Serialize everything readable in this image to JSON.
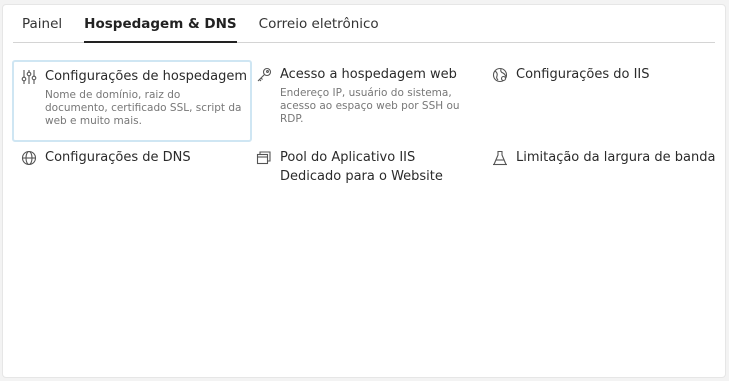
{
  "tabs": [
    {
      "label": "Painel"
    },
    {
      "label": "Hospedagem & DNS"
    },
    {
      "label": "Correio eletrônico"
    }
  ],
  "tiles": [
    {
      "title": "Configurações de hospedagem",
      "description": "Nome de domínio, raiz do documento, certificado SSL, script da web e muito mais.",
      "icon": "sliders-icon"
    },
    {
      "title": "Acesso a hospedagem web",
      "description": "Endereço IP, usuário do sistema, acesso ao espaço web por SSH ou RDP.",
      "icon": "key-icon"
    },
    {
      "title": "Configurações do IIS",
      "description": "",
      "icon": "globe-gear-icon"
    },
    {
      "title": "Configurações de DNS",
      "description": "",
      "icon": "globe-icon"
    },
    {
      "title": "Pool do Aplicativo IIS Dedicado para o Website",
      "description": "",
      "icon": "app-pool-icon"
    },
    {
      "title": "Limitação da largura de banda",
      "description": "",
      "icon": "bandwidth-icon"
    }
  ]
}
